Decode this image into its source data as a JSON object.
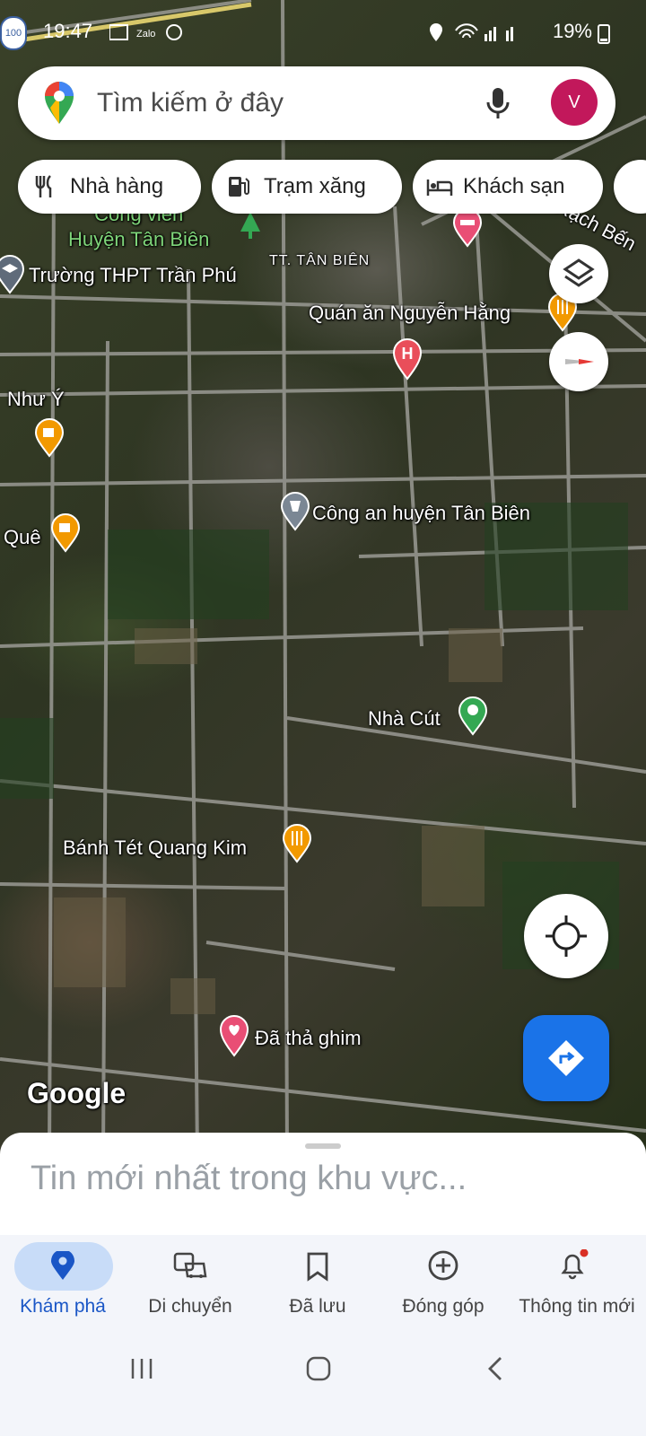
{
  "status_bar": {
    "time": "19:47",
    "battery": "19%"
  },
  "search": {
    "placeholder": "Tìm kiếm ở đây",
    "avatar_letter": "V"
  },
  "chips": [
    {
      "label": "Nhà hàng",
      "icon": "restaurant-icon"
    },
    {
      "label": "Trạm xăng",
      "icon": "gas-station-icon"
    },
    {
      "label": "Khách sạn",
      "icon": "hotel-icon"
    }
  ],
  "map": {
    "labels": {
      "park": "Công viên\nHuyện Tân Biên",
      "school": "Trường THPT Trần Phú",
      "town": "TT. TÂN BIÊN",
      "restaurant1": "Quán ăn Nguyễn Hằng",
      "nhu_y": "Như Ý",
      "que": "Quê",
      "police": "Công an huyện Tân Biên",
      "nha_cut": "Nhà Cút",
      "banh_tet": "Bánh Tét Quang Kim",
      "pinned": "Đã thả ghim",
      "rach": "Rạch Bến",
      "google": "Google",
      "route_badge": "100"
    }
  },
  "bottom_sheet": {
    "title": "Tin mới nhất trong khu vực..."
  },
  "bottom_nav": [
    {
      "label": "Khám phá",
      "icon": "explore-pin-icon",
      "active": true
    },
    {
      "label": "Di chuyển",
      "icon": "commute-icon",
      "active": false
    },
    {
      "label": "Đã lưu",
      "icon": "bookmark-icon",
      "active": false
    },
    {
      "label": "Đóng góp",
      "icon": "add-circle-icon",
      "active": false
    },
    {
      "label": "Thông tin mới",
      "icon": "bell-icon",
      "active": false
    }
  ],
  "colors": {
    "accent": "#1a73e8",
    "avatar": "#c2185b",
    "pin_orange": "#f29900",
    "pin_red": "#e94e5a",
    "pin_green": "#34a853"
  }
}
